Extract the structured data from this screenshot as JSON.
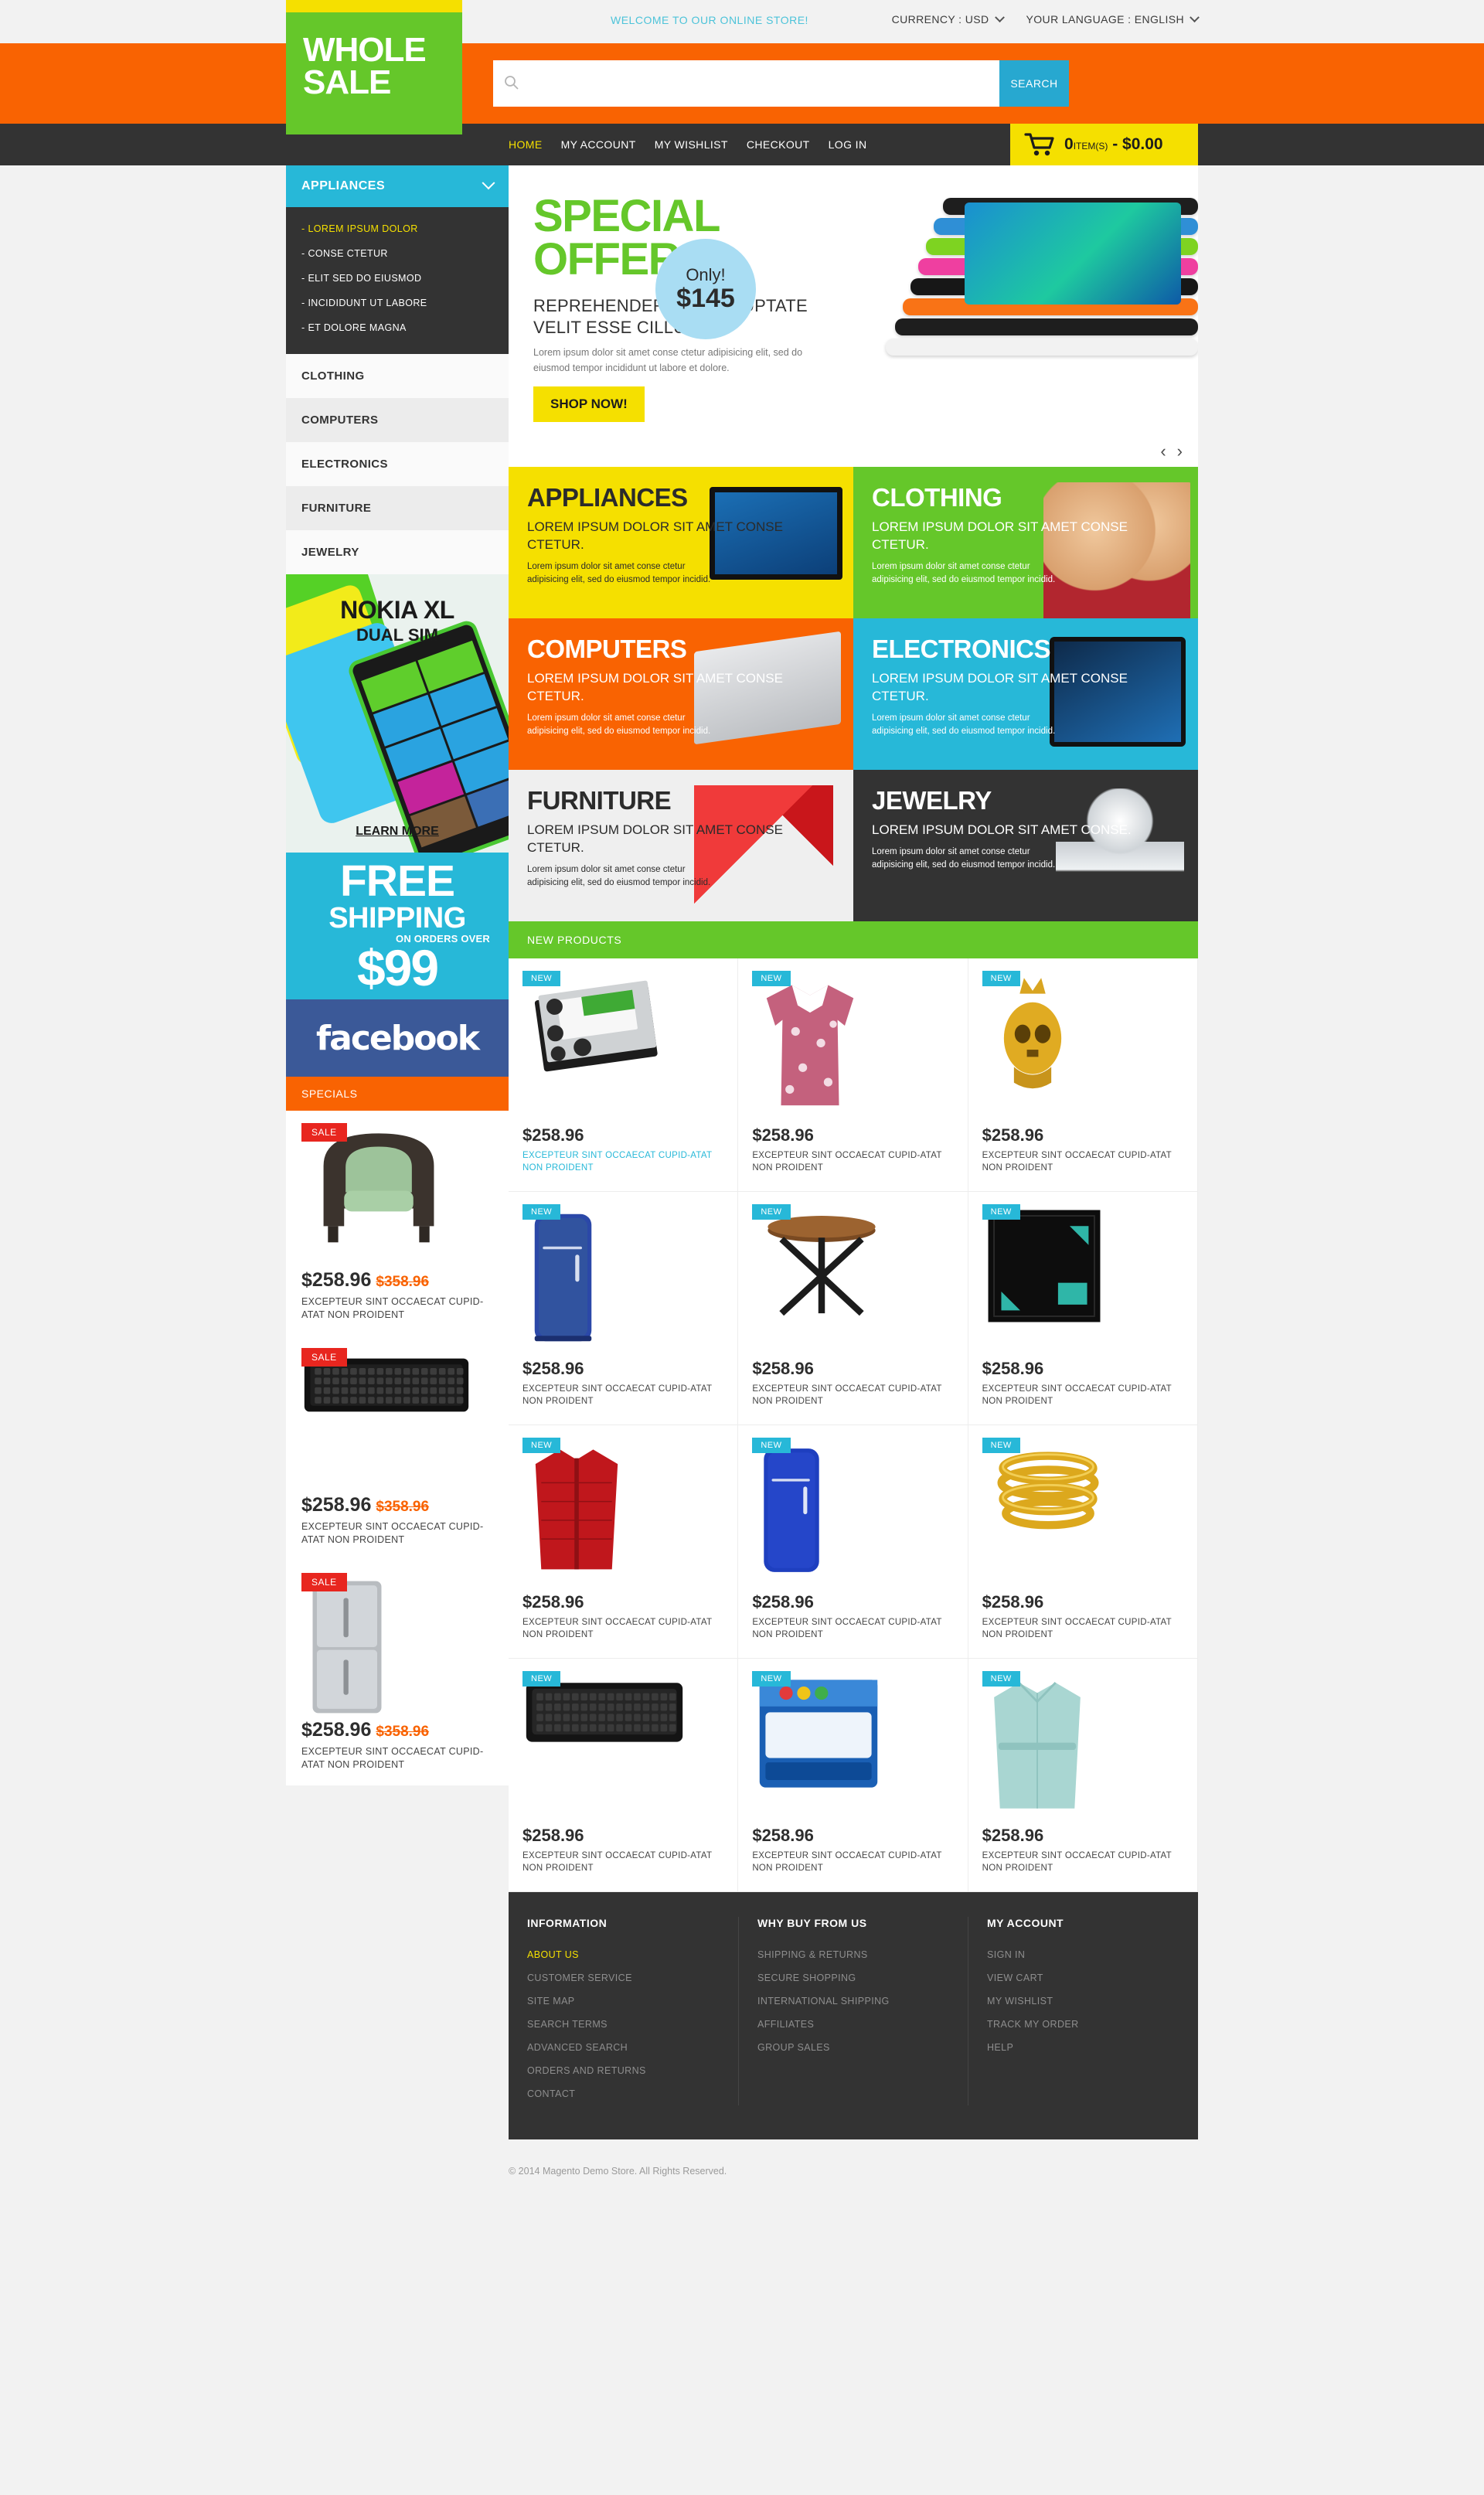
{
  "topbar": {
    "welcome": "WELCOME TO OUR ONLINE STORE!",
    "currency_label": "CURRENCY : USD",
    "language_label": "YOUR LANGUAGE : ENGLISH"
  },
  "header": {
    "logo_line1": "WHOLE",
    "logo_line2": "SALE",
    "search_placeholder": "",
    "search_value": "",
    "search_button": "SEARCH"
  },
  "nav": {
    "links": [
      {
        "label": "HOME",
        "active": true
      },
      {
        "label": "MY ACCOUNT",
        "active": false
      },
      {
        "label": "MY WISHLIST",
        "active": false
      },
      {
        "label": "CHECKOUT",
        "active": false
      },
      {
        "label": "LOG IN",
        "active": false
      }
    ],
    "cart_count": "0",
    "cart_items_label": "ITEM(S)",
    "cart_sep": "-",
    "cart_total": "$0.00"
  },
  "sidebar": {
    "categories_open": "APPLIANCES",
    "subitems": [
      {
        "label": "LOREM IPSUM DOLOR",
        "active": true
      },
      {
        "label": "CONSE CTETUR",
        "active": false
      },
      {
        "label": "ELIT SED DO EIUSMOD",
        "active": false
      },
      {
        "label": "INCIDIDUNT UT LABORE",
        "active": false
      },
      {
        "label": "ET DOLORE MAGNA",
        "active": false
      }
    ],
    "categories": [
      "CLOTHING",
      "COMPUTERS",
      "ELECTRONICS",
      "FURNITURE",
      "JEWELRY"
    ],
    "nokia": {
      "title": "NOKIA XL",
      "subtitle": "DUAL SIM",
      "cta": "LEARN MORE"
    },
    "shipping": {
      "line1": "FREE",
      "line2": "SHIPPING",
      "line3": "ON ORDERS OVER",
      "amount": "$99"
    },
    "facebook_label": "facebook",
    "specials_title": "SPECIALS",
    "specials": [
      {
        "badge": "SALE",
        "price": "$258.96",
        "old_price": "$358.96",
        "name": "EXCEPTEUR SINT OCCAECAT CUPID-ATAT NON PROIDENT",
        "art": "armchair"
      },
      {
        "badge": "SALE",
        "price": "$258.96",
        "old_price": "$358.96",
        "name": "EXCEPTEUR SINT OCCAECAT CUPID-ATAT NON PROIDENT",
        "art": "keyboard"
      },
      {
        "badge": "SALE",
        "price": "$258.96",
        "old_price": "$358.96",
        "name": "EXCEPTEUR SINT OCCAECAT CUPID-ATAT NON PROIDENT",
        "art": "fridge"
      }
    ]
  },
  "slider": {
    "title_line1": "SPECIAL",
    "title_line2": "OFFER",
    "subtitle_line1": "REPREHENDERIT IN VOLUPTATE",
    "subtitle_line2": "VELIT ESSE CILLUM DO",
    "description": "Lorem ipsum dolor sit amet conse ctetur adipisicing elit, sed do eiusmod tempor incididunt ut labore et dolore.",
    "button": "SHOP NOW!",
    "badge_only": "Only!",
    "badge_price": "$145",
    "prev": "‹",
    "next": "›"
  },
  "tiles": [
    {
      "title": "APPLIANCES",
      "subtitle": "LOREM IPSUM DOLOR SIT AMET CONSE CTETUR.",
      "text": "Lorem ipsum dolor sit amet conse ctetur adipisicing elit, sed do eiusmod tempor incidid.",
      "theme": "t-yellow"
    },
    {
      "title": "CLOTHING",
      "subtitle": "LOREM IPSUM DOLOR SIT AMET CONSE CTETUR.",
      "text": "Lorem ipsum dolor sit amet conse ctetur adipisicing elit, sed do eiusmod tempor incidid.",
      "theme": "t-green"
    },
    {
      "title": "COMPUTERS",
      "subtitle": "LOREM IPSUM DOLOR SIT AMET CONSE CTETUR.",
      "text": "Lorem ipsum dolor sit amet conse ctetur adipisicing elit, sed do eiusmod tempor incidid.",
      "theme": "t-orange"
    },
    {
      "title": "ELECTRONICS",
      "subtitle": "LOREM IPSUM DOLOR SIT AMET CONSE CTETUR.",
      "text": "Lorem ipsum dolor sit amet conse ctetur adipisicing elit, sed do eiusmod tempor incidid.",
      "theme": "t-cyan"
    },
    {
      "title": "FURNITURE",
      "subtitle": "LOREM IPSUM DOLOR SIT AMET CONSE CTETUR.",
      "text": "Lorem ipsum dolor sit amet conse ctetur adipisicing elit, sed do eiusmod tempor incidid.",
      "theme": "t-light"
    },
    {
      "title": "JEWELRY",
      "subtitle": "LOREM IPSUM DOLOR SIT AMET CONSE.",
      "text": "Lorem ipsum dolor sit amet conse ctetur adipisicing elit, sed do eiusmod tempor incidid.",
      "theme": "t-dark"
    }
  ],
  "new_products": {
    "title": "NEW PRODUCTS",
    "items": [
      {
        "badge": "NEW",
        "price": "$258.96",
        "name": "EXCEPTEUR SINT OCCAECAT CUPID-ATAT NON PROIDENT",
        "highlighted": true,
        "art": "harddrive"
      },
      {
        "badge": "NEW",
        "price": "$258.96",
        "name": "EXCEPTEUR SINT OCCAECAT CUPID-ATAT NON PROIDENT",
        "highlighted": false,
        "art": "blouse"
      },
      {
        "badge": "NEW",
        "price": "$258.96",
        "name": "EXCEPTEUR SINT OCCAECAT CUPID-ATAT NON PROIDENT",
        "highlighted": false,
        "art": "skullpendant"
      },
      {
        "badge": "NEW",
        "price": "$258.96",
        "name": "EXCEPTEUR SINT OCCAECAT CUPID-ATAT NON PROIDENT",
        "highlighted": false,
        "art": "bluefridge"
      },
      {
        "badge": "NEW",
        "price": "$258.96",
        "name": "EXCEPTEUR SINT OCCAECAT CUPID-ATAT NON PROIDENT",
        "highlighted": false,
        "art": "table"
      },
      {
        "badge": "NEW",
        "price": "$258.96",
        "name": "EXCEPTEUR SINT OCCAECAT CUPID-ATAT NON PROIDENT",
        "highlighted": false,
        "art": "amdcpu"
      },
      {
        "badge": "NEW",
        "price": "$258.96",
        "name": "EXCEPTEUR SINT OCCAECAT CUPID-ATAT NON PROIDENT",
        "highlighted": false,
        "art": "redvest"
      },
      {
        "badge": "NEW",
        "price": "$258.96",
        "name": "EXCEPTEUR SINT OCCAECAT CUPID-ATAT NON PROIDENT",
        "highlighted": false,
        "art": "bluefridge2"
      },
      {
        "badge": "NEW",
        "price": "$258.96",
        "name": "EXCEPTEUR SINT OCCAECAT CUPID-ATAT NON PROIDENT",
        "highlighted": false,
        "art": "goldbangles"
      },
      {
        "badge": "NEW",
        "price": "$258.96",
        "name": "EXCEPTEUR SINT OCCAECAT CUPID-ATAT NON PROIDENT",
        "highlighted": false,
        "art": "keyboard2"
      },
      {
        "badge": "NEW",
        "price": "$258.96",
        "name": "EXCEPTEUR SINT OCCAECAT CUPID-ATAT NON PROIDENT",
        "highlighted": false,
        "art": "intelcore"
      },
      {
        "badge": "NEW",
        "price": "$258.96",
        "name": "EXCEPTEUR SINT OCCAECAT CUPID-ATAT NON PROIDENT",
        "highlighted": false,
        "art": "mintcoat"
      }
    ]
  },
  "footer": {
    "columns": [
      {
        "title": "INFORMATION",
        "links": [
          {
            "label": "ABOUT US",
            "active": true
          },
          {
            "label": "CUSTOMER SERVICE",
            "active": false
          },
          {
            "label": "SITE MAP",
            "active": false
          },
          {
            "label": "SEARCH TERMS",
            "active": false
          },
          {
            "label": "ADVANCED SEARCH",
            "active": false
          },
          {
            "label": "ORDERS AND RETURNS",
            "active": false
          },
          {
            "label": "CONTACT",
            "active": false
          }
        ]
      },
      {
        "title": "WHY BUY FROM US",
        "links": [
          {
            "label": "SHIPPING & RETURNS",
            "active": false
          },
          {
            "label": "SECURE SHOPPING",
            "active": false
          },
          {
            "label": "INTERNATIONAL SHIPPING",
            "active": false
          },
          {
            "label": "AFFILIATES",
            "active": false
          },
          {
            "label": "GROUP SALES",
            "active": false
          }
        ]
      },
      {
        "title": "MY ACCOUNT",
        "links": [
          {
            "label": "SIGN IN",
            "active": false
          },
          {
            "label": "VIEW CART",
            "active": false
          },
          {
            "label": "MY WISHLIST",
            "active": false
          },
          {
            "label": "TRACK MY ORDER",
            "active": false
          },
          {
            "label": "HELP",
            "active": false
          }
        ]
      }
    ],
    "copyright": "© 2014 Magento Demo Store. All Rights Reserved."
  },
  "colors": {
    "orange": "#f96302",
    "green": "#65c72a",
    "yellow": "#f5e000",
    "cyan": "#27b8d8",
    "dark": "#333333",
    "sale_red": "#e8261f",
    "facebook_blue": "#3b5998"
  }
}
